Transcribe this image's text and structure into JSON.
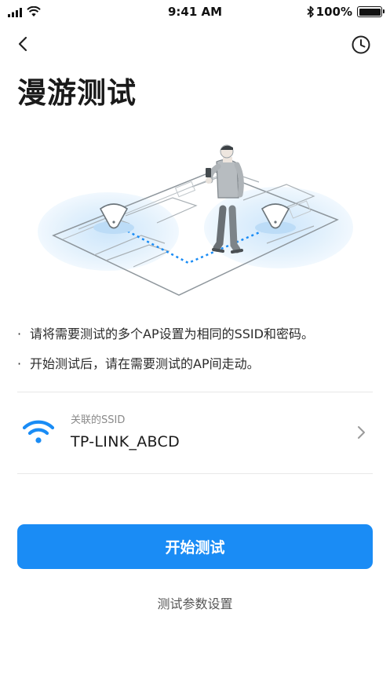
{
  "status_bar": {
    "time": "9:41 AM",
    "battery": "100%",
    "battery_level": 1.0,
    "icons": [
      "signal-icon",
      "wifi-icon",
      "bluetooth-icon",
      "battery-icon"
    ]
  },
  "nav": {
    "back_icon": "chevron-left-icon",
    "history_icon": "clock-icon"
  },
  "page": {
    "title": "漫游测试"
  },
  "tips": [
    {
      "bullet": "·",
      "text": "请将需要测试的多个AP设置为相同的SSID和密码。"
    },
    {
      "bullet": "·",
      "text": "开始测试后，请在需要测试的AP间走动。"
    }
  ],
  "ssid": {
    "label": "关联的SSID",
    "value": "TP-LINK_ABCD",
    "icon": "wifi-icon",
    "arrow_icon": "chevron-right-icon"
  },
  "actions": {
    "start_button": "开始测试",
    "params_link": "测试参数设置"
  },
  "colors": {
    "accent": "#1a8cf5",
    "background": "#ffffff",
    "text": "#1f1f1f",
    "muted": "#8a8a8a"
  }
}
